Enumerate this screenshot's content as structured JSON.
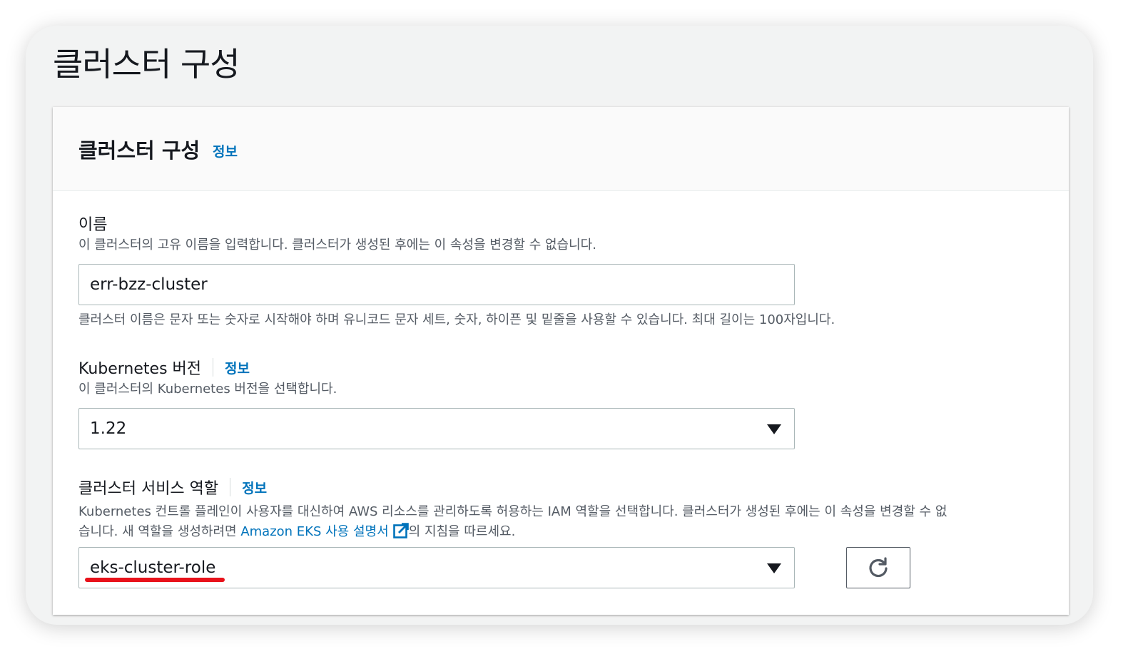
{
  "page": {
    "title": "클러스터 구성"
  },
  "panel": {
    "title": "클러스터 구성",
    "info": "정보"
  },
  "name_field": {
    "label": "이름",
    "description": "이 클러스터의 고유 이름을 입력합니다. 클러스터가 생성된 후에는 이 속성을 변경할 수 없습니다.",
    "value": "err-bzz-cluster",
    "constraint": "클러스터 이름은 문자 또는 숫자로 시작해야 하며 유니코드 문자 세트, 숫자, 하이픈 및 밑줄을 사용할 수 있습니다. 최대 길이는 100자입니다."
  },
  "version_field": {
    "label": "Kubernetes 버전",
    "info": "정보",
    "description": "이 클러스터의 Kubernetes 버전을 선택합니다.",
    "value": "1.22"
  },
  "role_field": {
    "label": "클러스터 서비스 역할",
    "info": "정보",
    "description_line1": "Kubernetes 컨트롤 플레인이 사용자를 대신하여 AWS 리소스를 관리하도록 허용하는 IAM 역할을 선택합니다. 클러스터가 생성된 후에는 이 속성을 변경할 수 없",
    "description_line2_prefix": "습니다. 새 역할을 생성하려면 ",
    "doc_link": "Amazon EKS 사용 설명서",
    "description_line2_suffix": "의 지침을 따르세요.",
    "value": "eks-cluster-role"
  },
  "icons": {
    "external_link": "external-link-icon",
    "refresh": "refresh-icon",
    "caret": "caret-down-icon"
  },
  "colors": {
    "link": "#0073bb",
    "highlight": "#e8121b"
  }
}
